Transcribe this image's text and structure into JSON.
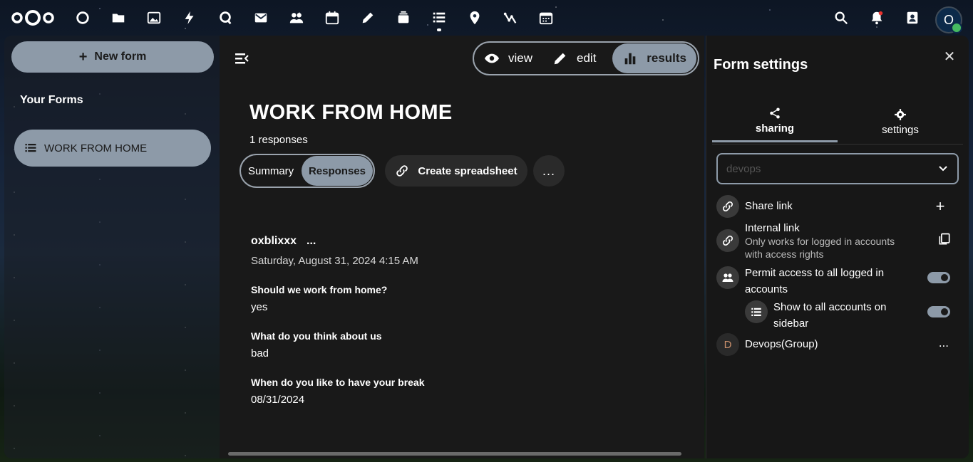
{
  "topbar": {
    "apps": [
      "dashboard-icon",
      "files-icon",
      "photos-icon",
      "activity-icon",
      "talk-icon",
      "mail-icon",
      "contacts-icon",
      "calendar-icon",
      "notes-icon",
      "deck-icon",
      "forms-icon",
      "maps-icon",
      "analytics-icon",
      "calendar-alt-icon"
    ],
    "right_icons": [
      "search-icon",
      "notifications-icon",
      "contacts-menu-icon"
    ],
    "avatar_initial": "O"
  },
  "leftnav": {
    "new_form_label": "New form",
    "your_forms_label": "Your Forms",
    "forms": [
      {
        "label": "WORK FROM HOME"
      }
    ]
  },
  "main": {
    "view_tabs": [
      {
        "label": "view"
      },
      {
        "label": "edit"
      },
      {
        "label": "results",
        "active": true
      }
    ],
    "title": "WORK FROM HOME",
    "response_count": "1 responses",
    "segments": [
      {
        "label": "Summary"
      },
      {
        "label": "Responses",
        "active": true
      }
    ],
    "create_spreadsheet_label": "Create spreadsheet",
    "more_label": "...",
    "response": {
      "user": "oxblixxx",
      "user_more": "...",
      "date": "Saturday, August 31, 2024 4:15 AM",
      "answers": [
        {
          "question": "Should we work from home?",
          "answer": "yes"
        },
        {
          "question": "What do you think about us",
          "answer": "bad"
        },
        {
          "question": "When do you like to have your break",
          "answer": "08/31/2024"
        }
      ]
    }
  },
  "sidebar": {
    "title": "Form settings",
    "tabs": [
      {
        "label": "sharing",
        "active": true
      },
      {
        "label": "settings"
      }
    ],
    "search_placeholder": "devops",
    "share_link_label": "Share link",
    "internal_link_label": "Internal link",
    "internal_link_sub": "Only works for logged in accounts with access rights",
    "permit_access_label": "Permit access to all logged in accounts",
    "show_sidebar_label": "Show to all accounts on sidebar",
    "group_initial": "D",
    "group_label": "Devops(Group)",
    "group_more": "..."
  },
  "colors": {
    "accent": "#8d9aa8",
    "panel": "#191919",
    "text": "#ffffff"
  }
}
